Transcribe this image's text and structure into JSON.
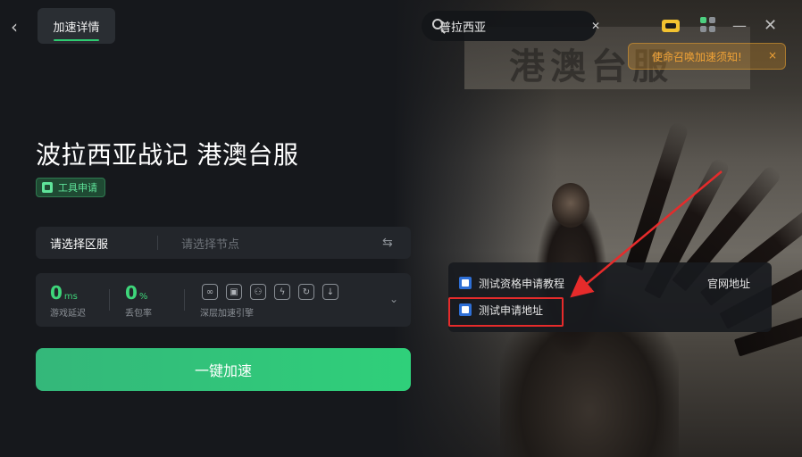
{
  "header": {
    "back_icon": "chevron-left-icon",
    "tab_label": "加速详情"
  },
  "search": {
    "value": "普拉西亚",
    "icon": "search-icon",
    "clear_icon": "close-icon"
  },
  "window": {
    "vip_icon": "crown-icon",
    "apps_icon": "apps-grid-icon",
    "minimize_glyph": "—",
    "close_glyph": "✕"
  },
  "notice": {
    "text": "使命召唤加速须知!",
    "close_glyph": "×"
  },
  "hero": {
    "banner_text": "港澳台服"
  },
  "game": {
    "title": "波拉西亚战记 港澳台服",
    "badge": "工具申请"
  },
  "region": {
    "label": "请选择区服",
    "node_placeholder": "请选择节点",
    "swap_glyph": "⇆"
  },
  "stats": {
    "latency_value": "0",
    "latency_unit": "ms",
    "latency_label": "游戏延迟",
    "loss_value": "0",
    "loss_unit": "%",
    "loss_label": "丢包率",
    "engine_label": "深层加速引擎",
    "engine_icons": [
      "link-icon",
      "image-icon",
      "share-icon",
      "bolt-icon",
      "refresh-icon",
      "download-icon"
    ],
    "expand_glyph": "⌄"
  },
  "accelerate": {
    "label": "一键加速"
  },
  "dropdown": {
    "items": [
      {
        "label": "测试资格申请教程"
      },
      {
        "label": "测试申请地址"
      }
    ],
    "official": "官网地址"
  },
  "colors": {
    "accent_green": "#2fd07a",
    "highlight_red": "#e62b2b",
    "notice_orange": "#f0a236"
  }
}
